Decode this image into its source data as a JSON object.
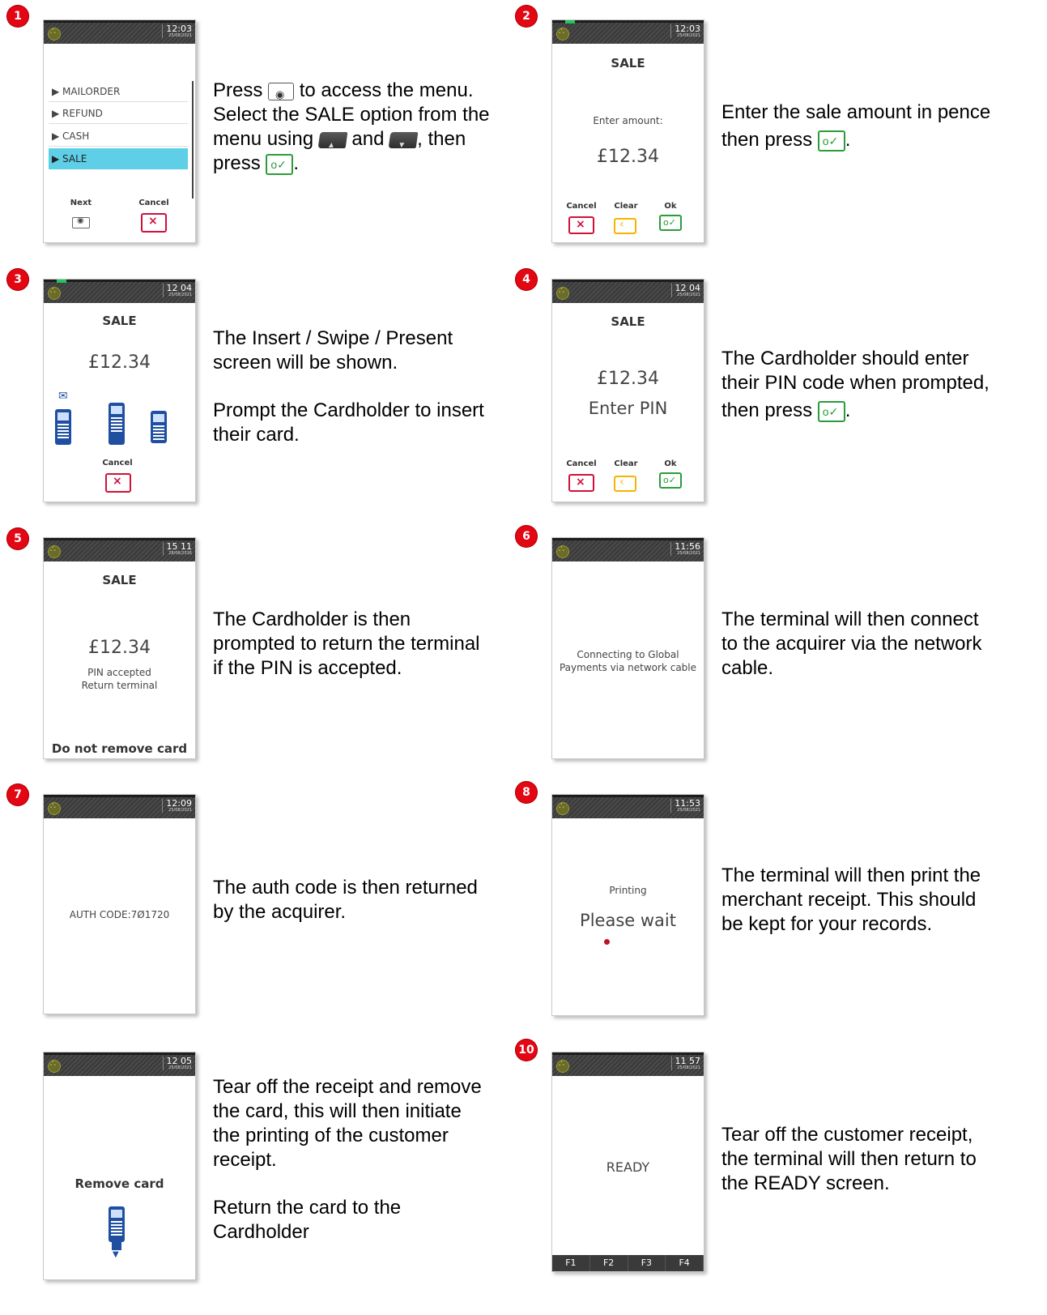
{
  "steps": [
    {
      "num": "1",
      "time": "12:03",
      "date": "25/08/2021",
      "menu": [
        "▶ MAILORDER",
        "▶ REFUND",
        "▶ CASH",
        "▶ SALE"
      ],
      "next_label": "Next",
      "cancel_label": "Cancel",
      "text_a": "Press",
      "text_b": "to access the menu.",
      "text_c": "Select the SALE option from the",
      "text_d": "menu using",
      "text_e": "and",
      "text_f": ", then",
      "text_g": "press",
      "text_h": "."
    },
    {
      "num": "2",
      "time": "12:03",
      "date": "25/08/2021",
      "title": "SALE",
      "prompt": "Enter amount:",
      "amount": "£12.34",
      "cancel_label": "Cancel",
      "clear_label": "Clear",
      "ok_label": "Ok",
      "text_a": "Enter the sale amount in pence",
      "text_b": "then press",
      "text_c": "."
    },
    {
      "num": "3",
      "time": "12 04",
      "date": "25/08/2021",
      "title": "SALE",
      "amount": "£12.34",
      "cancel_label": "Cancel",
      "text_a": "The Insert / Swipe / Present",
      "text_b": "screen will be shown.",
      "text_c": "Prompt the Cardholder to insert",
      "text_d": "their card."
    },
    {
      "num": "4",
      "time": "12 04",
      "date": "25/08/2021",
      "title": "SALE",
      "amount": "£12.34",
      "prompt": "Enter PIN",
      "cancel_label": "Cancel",
      "clear_label": "Clear",
      "ok_label": "Ok",
      "text_a": "The Cardholder should enter",
      "text_b": "their PIN code when prompted,",
      "text_c": "then press",
      "text_d": "."
    },
    {
      "num": "5",
      "time": "15 11",
      "date": "28/06/2016",
      "title": "SALE",
      "amount": "£12.34",
      "line1": "PIN accepted",
      "line2": "Return terminal",
      "footer": "Do not remove card",
      "text_a": "The Cardholder is then",
      "text_b": "prompted to return the terminal",
      "text_c": "if the PIN is accepted."
    },
    {
      "num": "6",
      "time": "11:56",
      "date": "25/08/2021",
      "line1": "Connecting to Global",
      "line2": "Payments via network cable",
      "text_a": "The terminal will then connect",
      "text_b": "to the acquirer via the network",
      "text_c": "cable."
    },
    {
      "num": "7",
      "time": "12:09",
      "date": "25/08/2021",
      "line1": "AUTH CODE:7Ø1720",
      "text_a": "The auth code is then returned",
      "text_b": "by the acquirer."
    },
    {
      "num": "8",
      "time": "11:53",
      "date": "25/08/2021",
      "line1": "Printing",
      "line2": "Please wait",
      "text_a": "The terminal will then print the",
      "text_b": "merchant receipt. This should",
      "text_c": "be kept for your records."
    },
    {
      "num": "9",
      "time": "12 05",
      "date": "25/08/2021",
      "line1": "Remove card",
      "text_a": "Tear off the receipt and remove",
      "text_b": "the card, this will then initiate",
      "text_c": "the printing of the customer",
      "text_d": "receipt.",
      "text_e": "Return the card to the",
      "text_f": "Cardholder"
    },
    {
      "num": "10",
      "time": "11 57",
      "date": "25/08/2021",
      "line1": "READY",
      "fkeys": [
        "F1",
        "F2",
        "F3",
        "F4"
      ],
      "text_a": "Tear off the customer receipt,",
      "text_b": "the terminal will then return to",
      "text_c": "the READY screen."
    }
  ],
  "colors": {
    "badge": "#e30613",
    "ok": "#2a9d3a",
    "cancel": "#d0103a",
    "clear": "#f5b400",
    "selected": "#5ecfe6",
    "terminal": "#1f4fa0"
  }
}
